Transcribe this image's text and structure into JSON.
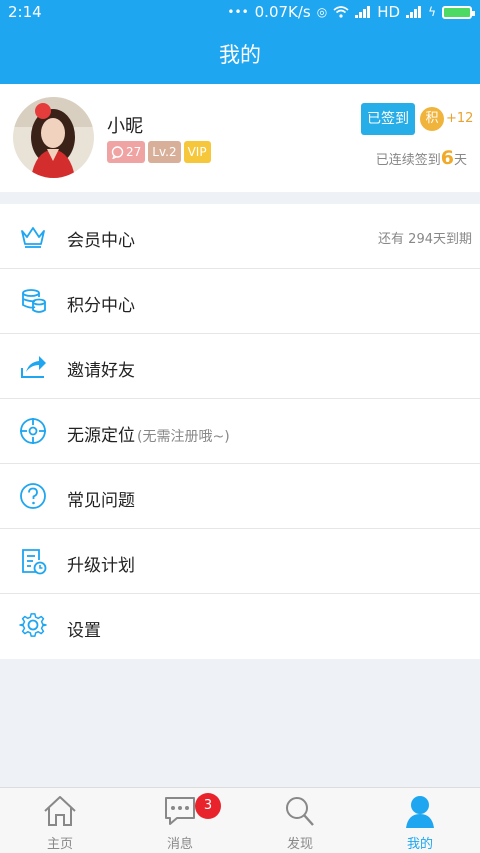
{
  "status_bar": {
    "time": "2:14",
    "network_speed": "0.07K/s",
    "signal_label": "HD"
  },
  "header": {
    "title": "我的"
  },
  "profile": {
    "username": "小昵",
    "message_count": "27",
    "level": "Lv.2",
    "vip": "VIP",
    "signed_button": "已签到",
    "points_icon_label": "积",
    "points_delta": "+12",
    "streak_prefix": "已连续签到",
    "streak_days": "6",
    "streak_suffix": "天"
  },
  "menu": [
    {
      "label": "会员中心",
      "right": "还有 294天到期",
      "icon": "crown-icon"
    },
    {
      "label": "积分中心",
      "icon": "coins-icon"
    },
    {
      "label": "邀请好友",
      "icon": "share-icon"
    },
    {
      "label": "无源定位",
      "hint": "(无需注册哦~)",
      "icon": "crosshair-icon"
    },
    {
      "label": "常见问题",
      "icon": "question-icon"
    },
    {
      "label": "升级计划",
      "icon": "document-clock-icon"
    },
    {
      "label": "设置",
      "icon": "gear-icon"
    }
  ],
  "tabs": [
    {
      "label": "主页",
      "icon": "home-icon"
    },
    {
      "label": "消息",
      "icon": "chat-icon",
      "badge": "3"
    },
    {
      "label": "发现",
      "icon": "search-icon"
    },
    {
      "label": "我的",
      "icon": "user-icon",
      "active": true
    }
  ],
  "colors": {
    "primary": "#1ea6f0",
    "badge_red": "#e8232b",
    "streak_orange": "#f0a928"
  }
}
